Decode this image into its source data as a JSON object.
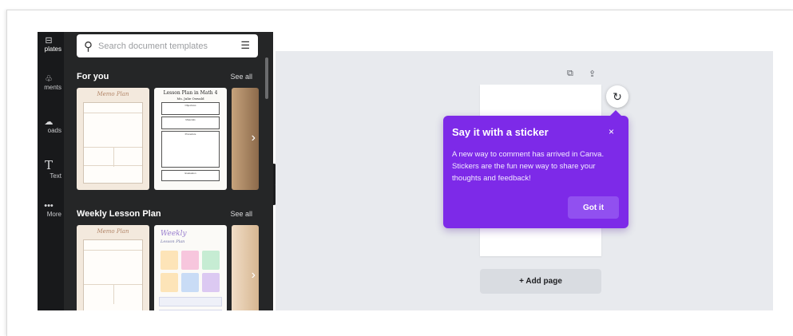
{
  "sidebar_rail": {
    "items": [
      {
        "label": "plates",
        "icon": "templates-icon"
      },
      {
        "label": "ments",
        "icon": "elements-icon"
      },
      {
        "label": "oads",
        "icon": "uploads-icon"
      },
      {
        "label": "Text",
        "icon": "text-icon"
      },
      {
        "label": "More",
        "icon": "more-icon"
      }
    ]
  },
  "search": {
    "placeholder": "Search document templates",
    "icon": "search-icon",
    "filter_icon": "filter-sliders-icon"
  },
  "sections": [
    {
      "title": "For you",
      "see_all": "See all"
    },
    {
      "title": "Weekly Lesson Plan",
      "see_all": "See all"
    }
  ],
  "thumbs": {
    "memo_title": "Memo Plan",
    "lesson_math_title": "Lesson Plan in Math 4",
    "lesson_math_subtitle": "Ms. Julie Oswald",
    "lesson_boxes": [
      "Objectives",
      "Materials",
      "Procedure",
      "Evaluation"
    ],
    "weekly_title": "Weekly",
    "weekly_subtitle": "Lesson Plan"
  },
  "canvas": {
    "add_page": "+ Add page",
    "copy_icon": "duplicate-page-icon",
    "add_icon": "add-page-icon",
    "refresh_icon": "refresh-comment-icon"
  },
  "popover": {
    "title": "Say it with a sticker",
    "close": "×",
    "body": "A new way to comment has arrived in Canva. Stickers are the fun new way to share your thoughts and feedback!",
    "button": "Got it"
  },
  "colors": {
    "accent_purple": "#7d2ae8",
    "panel_dark": "#252627",
    "workspace_bg": "#e8eaee"
  }
}
